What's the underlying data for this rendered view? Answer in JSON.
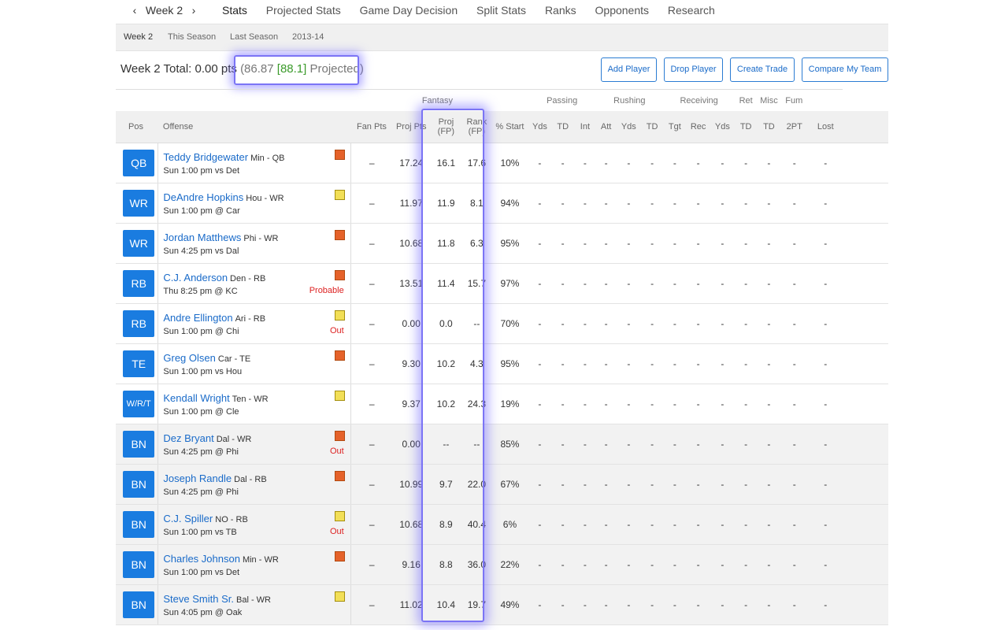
{
  "week_selector": {
    "prev": "‹",
    "label": "Week 2",
    "next": "›"
  },
  "tabs": [
    "Stats",
    "Projected Stats",
    "Game Day Decision",
    "Split Stats",
    "Ranks",
    "Opponents",
    "Research"
  ],
  "subtabs": [
    "Week 2",
    "This Season",
    "Last Season",
    "2013-14"
  ],
  "totals": {
    "label": "Week 2 Total:",
    "pts": "0.00 pts",
    "open": "(86.87",
    "bracket": "[88.1]",
    "projected": "Projected)"
  },
  "buttons": {
    "add": "Add Player",
    "drop": "Drop Player",
    "trade": "Create Trade",
    "compare": "Compare My Team"
  },
  "groups": {
    "fantasy": "Fantasy",
    "passing": "Passing",
    "rushing": "Rushing",
    "receiving": "Receiving",
    "ret": "Ret",
    "misc": "Misc",
    "fum": "Fum"
  },
  "headers": {
    "pos": "Pos",
    "offense": "Offense",
    "fan_pts": "Fan Pts",
    "proj_pts": "Proj Pts",
    "proj_fp1": "Proj",
    "proj_fp2": "(FP)",
    "rank_fp1": "Rank",
    "rank_fp2": "(FP)",
    "pct_start": "% Start",
    "stats": [
      "Yds",
      "TD",
      "Int",
      "Att",
      "Yds",
      "TD",
      "Tgt",
      "Rec",
      "Yds",
      "TD",
      "TD",
      "2PT",
      "Lost"
    ]
  },
  "players": [
    {
      "pos": "QB",
      "name": "Teddy Bridgewater",
      "team": "Min - QB",
      "game": "Sun 1:00 pm vs Det",
      "note": "orange",
      "status": "",
      "fan": "–",
      "proj": "17.24",
      "pfp": "16.1",
      "rfp": "17.6",
      "start": "10%",
      "bench": false
    },
    {
      "pos": "WR",
      "name": "DeAndre Hopkins",
      "team": "Hou - WR",
      "game": "Sun 1:00 pm @ Car",
      "note": "yellow",
      "status": "",
      "fan": "–",
      "proj": "11.97",
      "pfp": "11.9",
      "rfp": "8.1",
      "start": "94%",
      "bench": false
    },
    {
      "pos": "WR",
      "name": "Jordan Matthews",
      "team": "Phi - WR",
      "game": "Sun 4:25 pm vs Dal",
      "note": "orange",
      "status": "",
      "fan": "–",
      "proj": "10.68",
      "pfp": "11.8",
      "rfp": "6.3",
      "start": "95%",
      "bench": false
    },
    {
      "pos": "RB",
      "name": "C.J. Anderson",
      "team": "Den - RB",
      "game": "Thu 8:25 pm @ KC",
      "note": "orange",
      "status": "Probable",
      "fan": "–",
      "proj": "13.51",
      "pfp": "11.4",
      "rfp": "15.7",
      "start": "97%",
      "bench": false
    },
    {
      "pos": "RB",
      "name": "Andre Ellington",
      "team": "Ari - RB",
      "game": "Sun 1:00 pm @ Chi",
      "note": "yellow",
      "status": "Out",
      "fan": "–",
      "proj": "0.00",
      "pfp": "0.0",
      "rfp": "--",
      "start": "70%",
      "bench": false
    },
    {
      "pos": "TE",
      "name": "Greg Olsen",
      "team": "Car - TE",
      "game": "Sun 1:00 pm vs Hou",
      "note": "orange",
      "status": "",
      "fan": "–",
      "proj": "9.30",
      "pfp": "10.2",
      "rfp": "4.3",
      "start": "95%",
      "bench": false
    },
    {
      "pos": "W/R/T",
      "name": "Kendall Wright",
      "team": "Ten - WR",
      "game": "Sun 1:00 pm @ Cle",
      "note": "yellow",
      "status": "",
      "fan": "–",
      "proj": "9.37",
      "pfp": "10.2",
      "rfp": "24.3",
      "start": "19%",
      "bench": false
    },
    {
      "pos": "BN",
      "name": "Dez Bryant",
      "team": "Dal - WR",
      "game": "Sun 4:25 pm @ Phi",
      "note": "orange",
      "status": "Out",
      "fan": "–",
      "proj": "0.00",
      "pfp": "--",
      "rfp": "--",
      "start": "85%",
      "bench": true
    },
    {
      "pos": "BN",
      "name": "Joseph Randle",
      "team": "Dal - RB",
      "game": "Sun 4:25 pm @ Phi",
      "note": "orange",
      "status": "",
      "fan": "–",
      "proj": "10.99",
      "pfp": "9.7",
      "rfp": "22.0",
      "start": "67%",
      "bench": true
    },
    {
      "pos": "BN",
      "name": "C.J. Spiller",
      "team": "NO - RB",
      "game": "Sun 1:00 pm vs TB",
      "note": "yellow",
      "status": "Out",
      "fan": "–",
      "proj": "10.68",
      "pfp": "8.9",
      "rfp": "40.4",
      "start": "6%",
      "bench": true
    },
    {
      "pos": "BN",
      "name": "Charles Johnson",
      "team": "Min - WR",
      "game": "Sun 1:00 pm vs Det",
      "note": "orange",
      "status": "",
      "fan": "–",
      "proj": "9.16",
      "pfp": "8.8",
      "rfp": "36.0",
      "start": "22%",
      "bench": true
    },
    {
      "pos": "BN",
      "name": "Steve Smith Sr.",
      "team": "Bal - WR",
      "game": "Sun 4:05 pm @ Oak",
      "note": "yellow",
      "status": "",
      "fan": "–",
      "proj": "11.02",
      "pfp": "10.4",
      "rfp": "19.7",
      "start": "49%",
      "bench": true
    }
  ],
  "stat_dash": "-",
  "colors": {
    "accent": "#1a7ce0",
    "highlight": "#7b74f5",
    "out": "#dd2222",
    "projected_green": "#3a9a2a"
  }
}
